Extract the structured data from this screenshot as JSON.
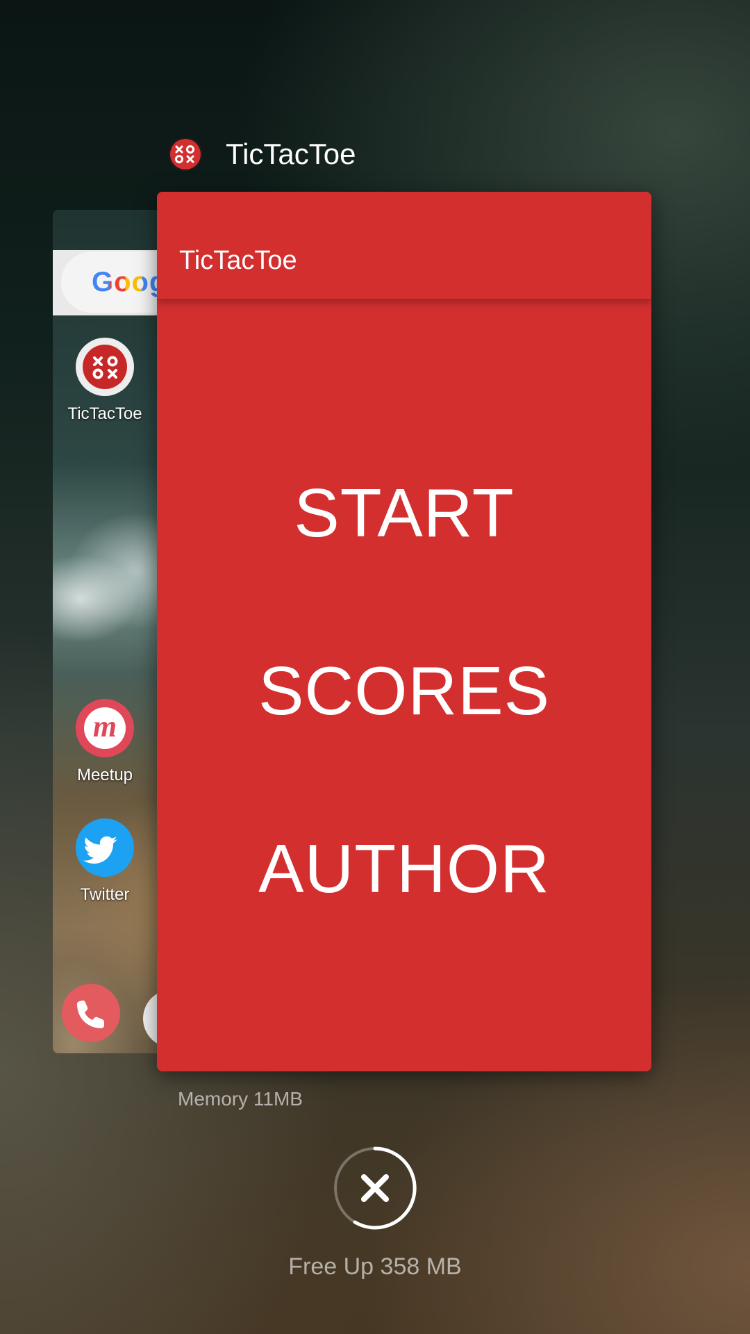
{
  "app_header": {
    "title": "TicTacToe",
    "icon": "tictactoe-app-icon"
  },
  "background_card": {
    "search_widget": {
      "text": "Googl"
    },
    "apps": [
      {
        "label": "TicTacToe",
        "icon": "tictactoe-app-icon"
      },
      {
        "label": "Meetup",
        "icon": "meetup-icon"
      },
      {
        "label": "Twitter",
        "icon": "twitter-icon"
      },
      {
        "label": "",
        "icon": "phone-icon"
      }
    ]
  },
  "card": {
    "toolbar_title": "TicTacToe",
    "menu": [
      "START",
      "SCORES",
      "AUTHOR"
    ],
    "color": "#d32f2f"
  },
  "memory": "Memory 11MB",
  "clear_all": {
    "icon": "close-icon",
    "label": "Free Up 358 MB"
  }
}
